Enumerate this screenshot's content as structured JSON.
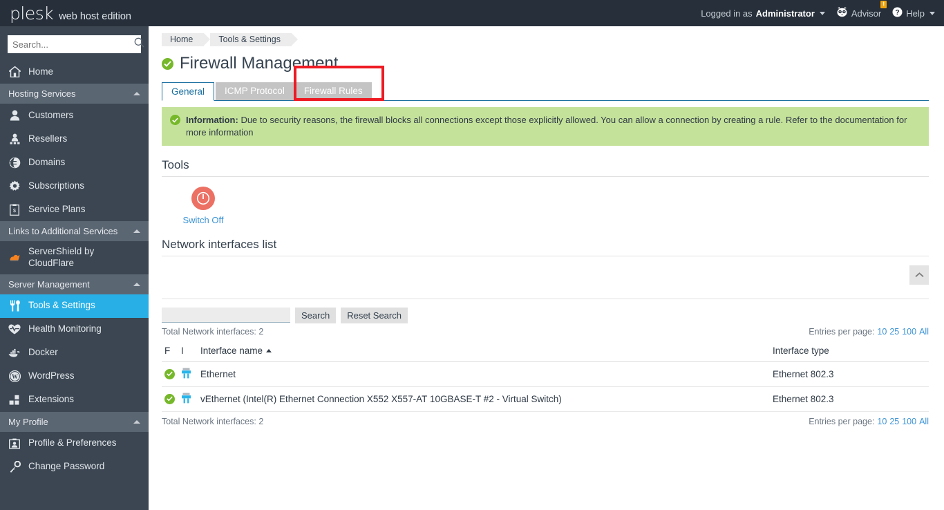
{
  "header": {
    "logo_main": "plesk",
    "logo_sub": "web host edition",
    "logged_in_label": "Logged in as",
    "user_name": "Administrator",
    "advisor_label": "Advisor",
    "advisor_badge": "!",
    "help_label": "Help"
  },
  "sidebar": {
    "search_placeholder": "Search...",
    "home_label": "Home",
    "groups": [
      {
        "title": "Hosting Services",
        "items": [
          {
            "label": "Customers",
            "icon": "user-icon"
          },
          {
            "label": "Resellers",
            "icon": "reseller-icon"
          },
          {
            "label": "Domains",
            "icon": "globe-icon"
          },
          {
            "label": "Subscriptions",
            "icon": "gear-icon"
          },
          {
            "label": "Service Plans",
            "icon": "clipboard-icon"
          }
        ]
      },
      {
        "title": "Links to Additional Services",
        "items": [
          {
            "label": "ServerShield by CloudFlare",
            "icon": "cloudflare-icon"
          }
        ]
      },
      {
        "title": "Server Management",
        "items": [
          {
            "label": "Tools & Settings",
            "icon": "tools-icon",
            "active": true
          },
          {
            "label": "Health Monitoring",
            "icon": "heartbeat-icon"
          },
          {
            "label": "Docker",
            "icon": "docker-icon"
          },
          {
            "label": "WordPress",
            "icon": "wordpress-icon"
          },
          {
            "label": "Extensions",
            "icon": "extensions-icon"
          }
        ]
      },
      {
        "title": "My Profile",
        "items": [
          {
            "label": "Profile & Preferences",
            "icon": "profile-icon"
          },
          {
            "label": "Change Password",
            "icon": "key-icon"
          }
        ]
      }
    ]
  },
  "breadcrumb": [
    "Home",
    "Tools & Settings"
  ],
  "page": {
    "title": "Firewall Management",
    "status_icon": "check-circle-icon"
  },
  "tabs": [
    {
      "label": "General",
      "active": true
    },
    {
      "label": "ICMP Protocol",
      "active": false
    },
    {
      "label": "Firewall Rules",
      "active": false,
      "highlighted": true
    }
  ],
  "highlight_color": "#ee1b24",
  "info_banner": {
    "icon": "check-circle-icon",
    "strong": "Information:",
    "text": " Due to security reasons, the firewall blocks all connections except those explicitly allowed. You can allow a connection by creating a rule. Refer to the documentation for more information"
  },
  "tools": {
    "heading": "Tools",
    "switch_off_label": "Switch Off",
    "switch_off_icon": "power-icon"
  },
  "network_list": {
    "heading": "Network interfaces list",
    "collapse_icon": "chevron-up-icon",
    "filter_value": "",
    "search_button": "Search",
    "reset_button": "Reset Search",
    "total_label": "Total Network interfaces: 2",
    "entries_label": "Entries per page:",
    "entries_options": [
      "10",
      "25",
      "100",
      "All"
    ],
    "columns": [
      "F",
      "I",
      "Interface name",
      "Interface type"
    ],
    "sort_column": "Interface name",
    "sort_direction": "asc",
    "rows": [
      {
        "status_icon": "check-circle-icon",
        "type_icon": "network-plug-icon",
        "name": "Ethernet",
        "type": "Ethernet 802.3"
      },
      {
        "status_icon": "check-circle-icon",
        "type_icon": "network-plug-icon",
        "name": "vEthernet (Intel(R) Ethernet Connection X552 X557-AT 10GBASE-T #2 - Virtual Switch)",
        "type": "Ethernet 802.3"
      }
    ]
  }
}
